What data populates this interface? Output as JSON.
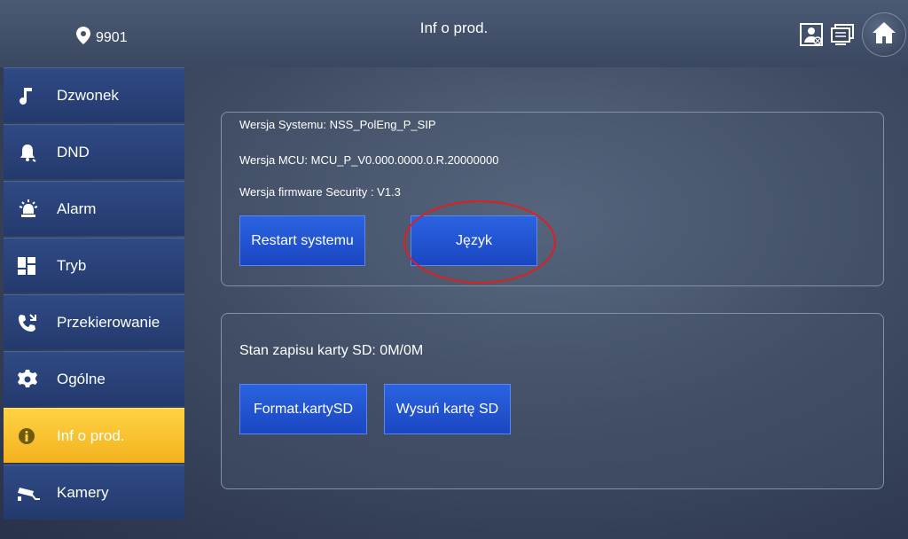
{
  "header": {
    "location_number": "9901",
    "title": "Inf o prod."
  },
  "icons": {
    "location": "map-pin-icon",
    "sd_card": "sd-card-status-icon",
    "monitor": "monitor-icon",
    "home": "home-icon"
  },
  "sidebar": {
    "items": [
      {
        "label": "Dzwonek",
        "icon": "music-note-icon",
        "active": false
      },
      {
        "label": "DND",
        "icon": "bell-icon",
        "active": false
      },
      {
        "label": "Alarm",
        "icon": "alarm-siren-icon",
        "active": false
      },
      {
        "label": "Tryb",
        "icon": "grid-mode-icon",
        "active": false
      },
      {
        "label": "Przekierowanie",
        "icon": "call-forward-icon",
        "active": false
      },
      {
        "label": "Ogólne",
        "icon": "gear-icon",
        "active": false
      },
      {
        "label": "Inf o prod.",
        "icon": "info-icon",
        "active": true
      },
      {
        "label": "Kamery",
        "icon": "camera-icon",
        "active": false
      }
    ]
  },
  "system_panel": {
    "system_version": "Wersja Systemu: NSS_PolEng_P_SIP",
    "mcu_version": "Wersja MCU: MCU_P_V0.000.0000.0.R.20000000",
    "security_firmware": "Wersja firmware Security : V1.3",
    "restart_label": "Restart systemu",
    "language_label": "Język"
  },
  "sd_panel": {
    "status": "Stan zapisu karty SD: 0M/0M",
    "format_label": "Format.kartySD",
    "eject_label": "Wysuń kartę SD"
  },
  "colors": {
    "accent_active": "#f3b21e",
    "sidebar_item": "#2a4378",
    "button": "#1f50d0",
    "highlight": "#e01e1e"
  }
}
